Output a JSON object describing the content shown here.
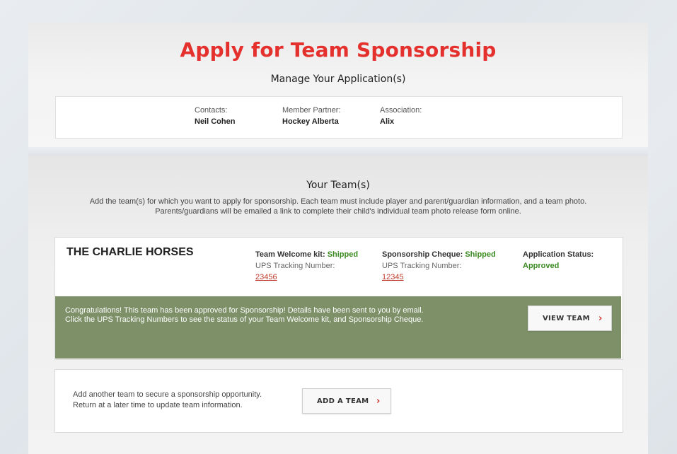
{
  "header": {
    "title": "Apply for Team Sponsorship",
    "subtitle": "Manage Your Application(s)"
  },
  "contacts": [
    {
      "label": "Contacts:",
      "value": "Neil Cohen"
    },
    {
      "label": "Member Partner:",
      "value": "Hockey Alberta"
    },
    {
      "label": "Association:",
      "value": "Alix"
    }
  ],
  "teams_section": {
    "title": "Your Team(s)",
    "description_line1": "Add the team(s) for which you want to apply for sponsorship. Each team must include player and parent/guardian information, and a team photo.",
    "description_line2": "Parents/guardians will be emailed a link to complete their child's individual team photo release form online."
  },
  "team": {
    "name": "THE CHARLIE HORSES",
    "welcome_kit": {
      "label": "Team Welcome kit:",
      "status": "Shipped",
      "tracking_label": "UPS Tracking Number:",
      "tracking_number": "23456"
    },
    "cheque": {
      "label": "Sponsorship Cheque:",
      "status": "Shipped",
      "tracking_label": "UPS Tracking Number:",
      "tracking_number": "12345"
    },
    "application": {
      "label": "Application Status:",
      "status": "Approved"
    },
    "message_line1": "Congratulations! This team has been approved for Sponsorship! Details have been sent to you by email.",
    "message_line2": "Click the UPS Tracking Numbers to see the status of your Team Welcome kit, and Sponsorship Cheque.",
    "view_button": "VIEW TEAM"
  },
  "add_team": {
    "line1": "Add another team to secure a sponsorship opportunity.",
    "line2": "Return at a later time to update team information.",
    "button": "ADD A TEAM"
  },
  "icons": {
    "chevron": "chevron-right-icon"
  },
  "colors": {
    "title_red": "#e4312d",
    "status_green": "#3c8a22",
    "banner_green": "#7d9068",
    "link_red": "#c0392b"
  }
}
